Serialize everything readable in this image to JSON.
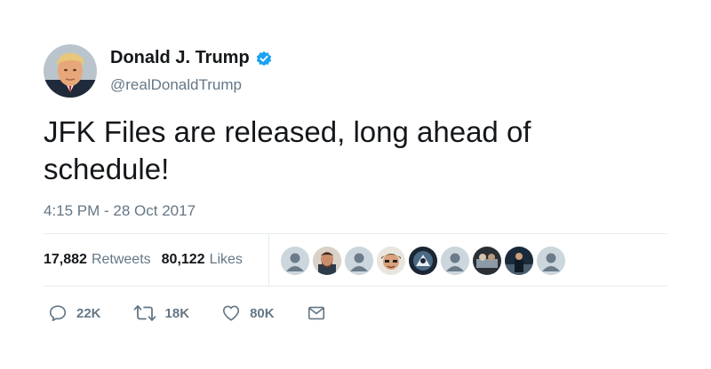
{
  "author": {
    "name": "Donald J. Trump",
    "handle": "@realDonaldTrump",
    "verified": true
  },
  "tweet": {
    "text": "JFK Files are released, long ahead of schedule!",
    "timestamp": "4:15 PM - 28 Oct 2017"
  },
  "stats": {
    "retweets_count": "17,882",
    "retweets_label": "Retweets",
    "likes_count": "80,122",
    "likes_label": "Likes"
  },
  "actions": {
    "reply_count": "22K",
    "retweet_count": "18K",
    "like_count": "80K"
  },
  "colors": {
    "verified_blue": "#1da1f2",
    "secondary_text": "#657786",
    "divider": "#e6ecf0"
  }
}
